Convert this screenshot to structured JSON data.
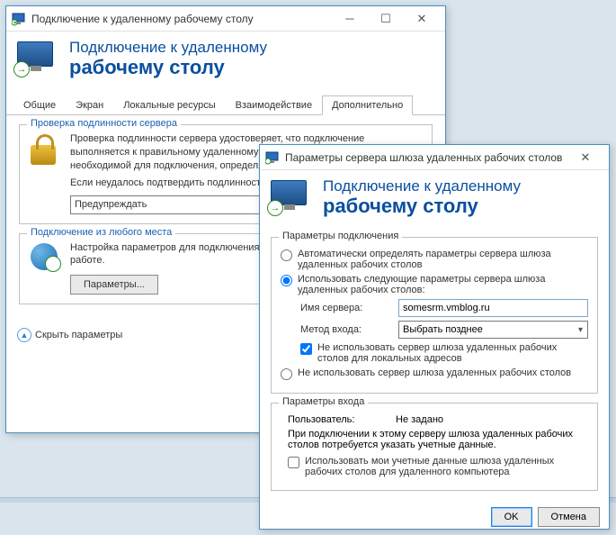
{
  "main": {
    "title": "Подключение к удаленному рабочему столу",
    "banner": {
      "line1": "Подключение к удаленному",
      "line2": "рабочему столу"
    },
    "tabs": [
      "Общие",
      "Экран",
      "Локальные ресурсы",
      "Взаимодействие",
      "Дополнительно"
    ],
    "active_tab": 4,
    "auth_group": {
      "title": "Проверка подлинности сервера",
      "text1": "Проверка подлинности сервера удостоверяет, что подключение выполняется к правильному удаленному компьютеру. Строгость проверки, необходимой для подключения, определяется политикой безопасности.",
      "text2": "Если неудалось подтвердить подлинность удаленного компьютера:",
      "select_value": "Предупреждать"
    },
    "any_group": {
      "title": "Подключение из любого места",
      "text": "Настройка параметров для подключения через шлюз при удаленной работе.",
      "button": "Параметры..."
    },
    "hide": "Скрыть параметры"
  },
  "dialog": {
    "title": "Параметры сервера шлюза удаленных рабочих столов",
    "banner": {
      "line1": "Подключение к удаленному",
      "line2": "рабочему столу"
    },
    "conn_group": {
      "title": "Параметры подключения",
      "opt_auto": "Автоматически определять параметры сервера шлюза удаленных рабочих столов",
      "opt_use": "Использовать следующие параметры сервера шлюза удаленных рабочих столов:",
      "server_label": "Имя сервера:",
      "server_value": "somesrm.vmblog.ru",
      "method_label": "Метод входа:",
      "method_value": "Выбрать позднее",
      "chk_bypass": "Не использовать сервер шлюза удаленных рабочих столов для локальных адресов",
      "opt_none": "Не использовать сервер шлюза удаленных рабочих столов"
    },
    "login_group": {
      "title": "Параметры входа",
      "user_label": "Пользователь:",
      "user_value": "Не задано",
      "note": "При подключении к этому серверу шлюза удаленных рабочих столов потребуется указать учетные данные.",
      "chk_share": "Использовать мои учетные данные шлюза удаленных рабочих столов для удаленного компьютера"
    },
    "ok": "OK",
    "cancel": "Отмена"
  }
}
